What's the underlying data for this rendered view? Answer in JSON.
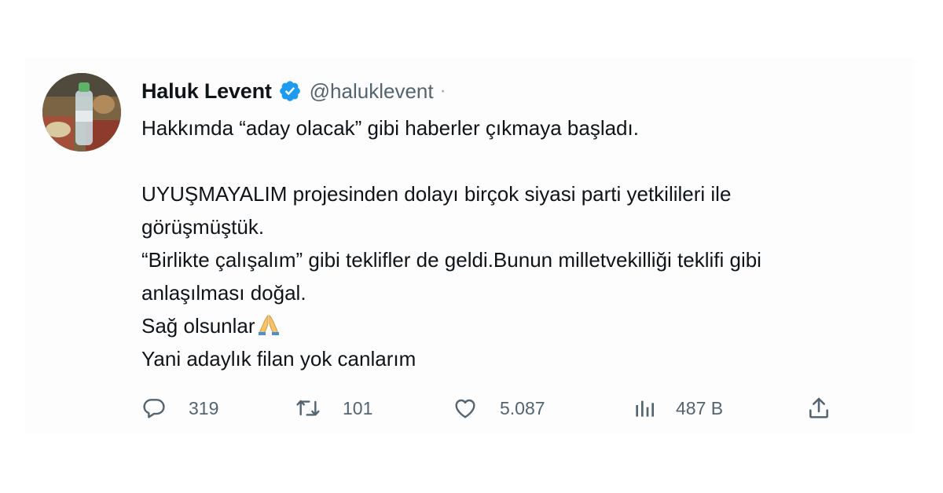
{
  "tweet": {
    "author": {
      "display_name": "Haluk Levent",
      "handle": "@haluklevent",
      "verified": true,
      "separator": "·"
    },
    "lines": {
      "l1": "Hakkımda “aday olacak” gibi haberler çıkmaya başladı.",
      "l2": "UYUŞMAYALIM projesinden dolayı birçok siyasi parti yetkilileri ile",
      "l3": "görüşmüştük.",
      "l4": "“Birlikte çalışalım” gibi teklifler de geldi.Bunun milletvekilliği teklifi gibi",
      "l5": "anlaşılması doğal.",
      "l6": "Sağ olsunlar",
      "l7": "Yani adaylık filan yok canlarım"
    },
    "stats": {
      "replies": "319",
      "retweets": "101",
      "likes": "5.087",
      "views": "487 B"
    },
    "icons": {
      "reply": "speech-bubble-icon",
      "retweet": "retweet-arrows-icon",
      "like": "heart-icon",
      "views": "bar-chart-icon",
      "share": "upload-share-icon",
      "verified": "verified-badge-icon",
      "emoji": "folded-hands-emoji"
    },
    "colors": {
      "verified": "#1d9bf0",
      "text": "#0f1419",
      "muted": "#536471"
    }
  }
}
